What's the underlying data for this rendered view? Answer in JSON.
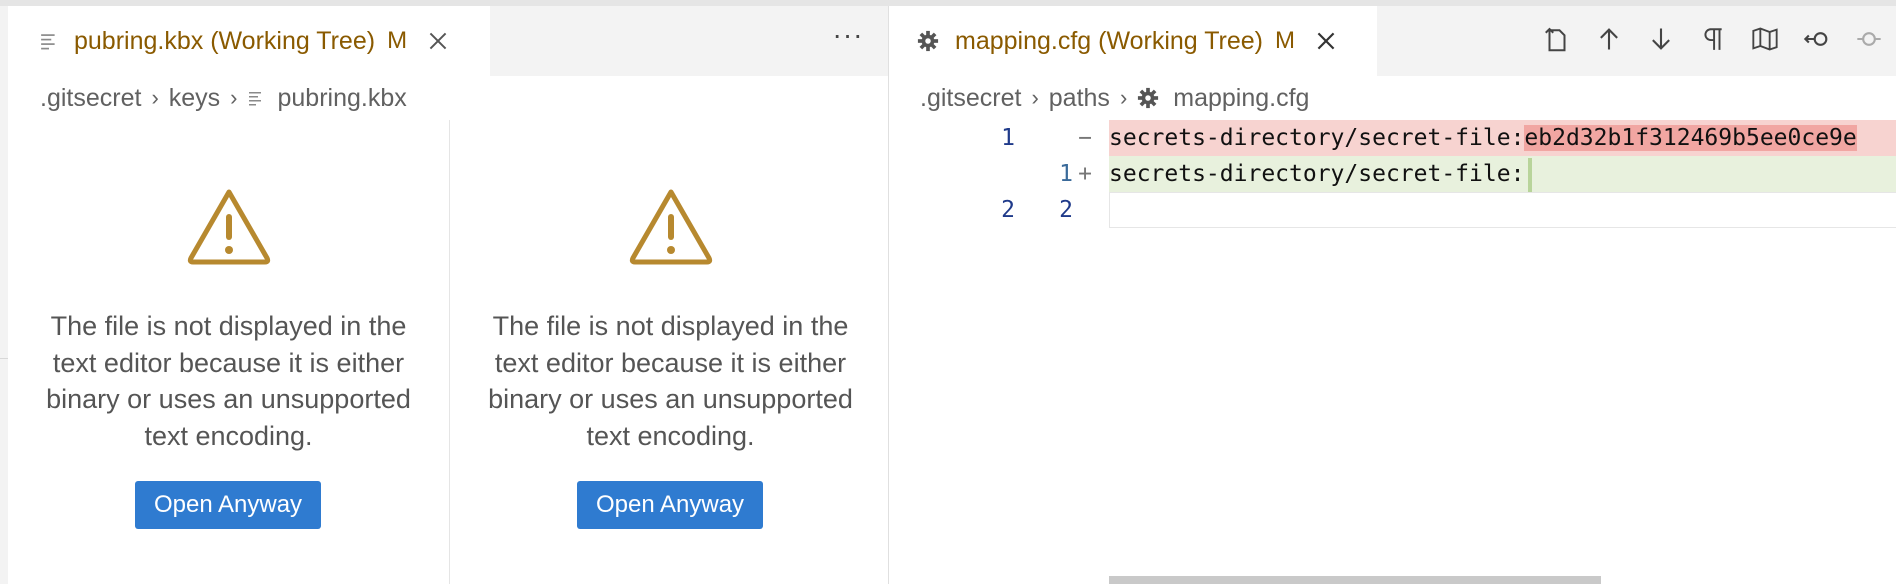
{
  "left_group": {
    "tab": {
      "title": "pubring.kbx (Working Tree)",
      "modified": "M"
    },
    "more_label": "···",
    "breadcrumb": [
      ".gitsecret",
      "keys",
      "pubring.kbx"
    ],
    "panes": [
      {
        "message": "The file is not displayed in the text editor because it is either binary or uses an unsupported text encoding.",
        "button": "Open Anyway"
      },
      {
        "message": "The file is not displayed in the text editor because it is either binary or uses an unsupported text encoding.",
        "button": "Open Anyway"
      }
    ]
  },
  "right_group": {
    "tab": {
      "title": "mapping.cfg (Working Tree)",
      "modified": "M"
    },
    "breadcrumb": [
      ".gitsecret",
      "paths",
      "mapping.cfg"
    ],
    "toolbar_icons": [
      "open-changes-icon",
      "previous-change-icon",
      "next-change-icon",
      "show-whitespace-icon",
      "minimap-icon",
      "revert-icon",
      "commit-icon"
    ],
    "diff": {
      "removed": {
        "old_no": "1",
        "marker": "−",
        "text": "secrets-directory/secret-file:",
        "hash": "eb2d32b1f312469b5ee0ce9e"
      },
      "added": {
        "new_no": "1",
        "marker": "+",
        "text": "secrets-directory/secret-file:"
      },
      "context": {
        "old_no": "2",
        "new_no": "2"
      }
    }
  },
  "colors": {
    "tab_modified": "#8a5a00",
    "button_bg": "#2f7bd0",
    "removed_bg": "#f7d3d0",
    "added_bg": "#e8f1dd"
  }
}
